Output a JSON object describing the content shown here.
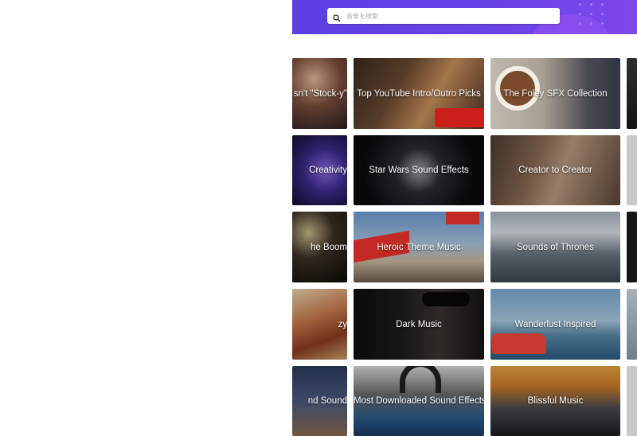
{
  "search": {
    "placeholder": "音楽を検索",
    "icon": "search-icon"
  },
  "colors": {
    "header_start": "#5b3fe3",
    "header_end": "#7e47e8",
    "tile_text": "#ffffff"
  },
  "tiles": [
    {
      "label": "sn't \"Stock-y\""
    },
    {
      "label": "Top YouTube Intro/Outro Picks"
    },
    {
      "label": "The Foley SFX Collection"
    },
    {
      "label": ""
    },
    {
      "label": "Creativity"
    },
    {
      "label": "Star Wars Sound Effects"
    },
    {
      "label": "Creator to Creator"
    },
    {
      "label": ""
    },
    {
      "label": "he Boom"
    },
    {
      "label": "Heroic Theme Music"
    },
    {
      "label": "Sounds of Thrones"
    },
    {
      "label": ""
    },
    {
      "label": "zy"
    },
    {
      "label": "Dark Music"
    },
    {
      "label": "Wanderlust Inspired"
    },
    {
      "label": ""
    },
    {
      "label": "nd Sound"
    },
    {
      "label": "Most Downloaded Sound Effects"
    },
    {
      "label": "Blissful Music"
    },
    {
      "label": ""
    }
  ]
}
